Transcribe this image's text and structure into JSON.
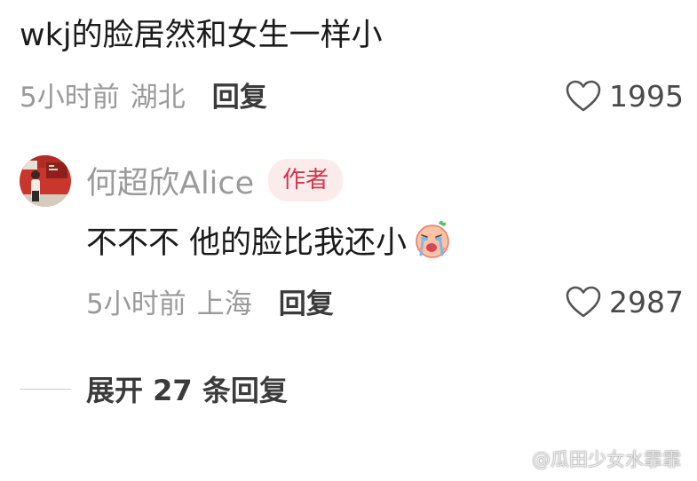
{
  "comment": {
    "text": "wkj的脸居然和女生一样小",
    "time": "5小时前",
    "location": "湖北",
    "reply_label": "回复",
    "likes": "1995",
    "like_icon": "heart-outline-icon"
  },
  "reply": {
    "username": "何超欣Alice",
    "badge": "作者",
    "text": "不不不 他的脸比我还小",
    "emoji": "crying-face-emoji",
    "time": "5小时前",
    "location": "上海",
    "reply_label": "回复",
    "likes": "2987",
    "like_icon": "heart-outline-icon"
  },
  "expand": {
    "label": "展开 27 条回复"
  },
  "watermark": {
    "text": "@瓜田少女水霏霏"
  },
  "colors": {
    "meta_gray": "#9a9a9a",
    "badge_bg": "#fbecec",
    "badge_text": "#d6334a",
    "text_main": "#1b1b1b"
  }
}
